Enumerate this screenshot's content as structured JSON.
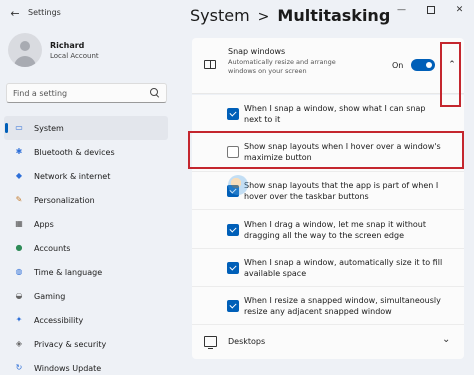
{
  "window": {
    "app_title": "Settings",
    "back_icon": "back-arrow-icon",
    "minimize_glyph": "—",
    "close_glyph": "✕"
  },
  "profile": {
    "name": "Richard",
    "account": "Local Account"
  },
  "search": {
    "placeholder": "Find a setting"
  },
  "sidebar": {
    "items": [
      {
        "label": "System",
        "icon": "system-icon",
        "glyph": "▭",
        "color": "#2e6fd8",
        "active": true
      },
      {
        "label": "Bluetooth & devices",
        "icon": "bluetooth-icon",
        "glyph": "✱",
        "color": "#2e6fd8"
      },
      {
        "label": "Network & internet",
        "icon": "wifi-icon",
        "glyph": "◆",
        "color": "#2e6fd8"
      },
      {
        "label": "Personalization",
        "icon": "brush-icon",
        "glyph": "✎",
        "color": "#c47a2c"
      },
      {
        "label": "Apps",
        "icon": "apps-icon",
        "glyph": "▦",
        "color": "#555555"
      },
      {
        "label": "Accounts",
        "icon": "accounts-icon",
        "glyph": "●",
        "color": "#2e8b57"
      },
      {
        "label": "Time & language",
        "icon": "globe-icon",
        "glyph": "◍",
        "color": "#2e6fd8"
      },
      {
        "label": "Gaming",
        "icon": "gaming-icon",
        "glyph": "◒",
        "color": "#666666"
      },
      {
        "label": "Accessibility",
        "icon": "accessibility-icon",
        "glyph": "✦",
        "color": "#2e6fd8"
      },
      {
        "label": "Privacy & security",
        "icon": "shield-icon",
        "glyph": "◈",
        "color": "#666666"
      },
      {
        "label": "Windows Update",
        "icon": "update-icon",
        "glyph": "↻",
        "color": "#2e6fd8"
      }
    ]
  },
  "header": {
    "section": "System",
    "separator": ">",
    "current": "Multitasking"
  },
  "snap": {
    "title": "Snap windows",
    "description": "Automatically resize and arrange windows on your screen",
    "toggle_label": "On",
    "toggle_on": true,
    "collapse_glyph": "⌃"
  },
  "options": [
    {
      "text": "When I snap a window, show what I can snap next to it",
      "checked": true
    },
    {
      "text": "Show snap layouts when I hover over a window's maximize button",
      "checked": false
    },
    {
      "text": "Show snap layouts that the app is part of when I hover over the taskbar buttons",
      "checked": true
    },
    {
      "text": "When I drag a window, let me snap it without dragging all the way to the screen edge",
      "checked": true
    },
    {
      "text": "When I snap a window, automatically size it to fill available space",
      "checked": true
    },
    {
      "text": "When I resize a snapped window, simultaneously resize any adjacent snapped window",
      "checked": true
    }
  ],
  "desktops": {
    "label": "Desktops",
    "chevron": "⌄"
  },
  "colors": {
    "accent": "#005fb8",
    "highlight_box": "#c4262e"
  }
}
